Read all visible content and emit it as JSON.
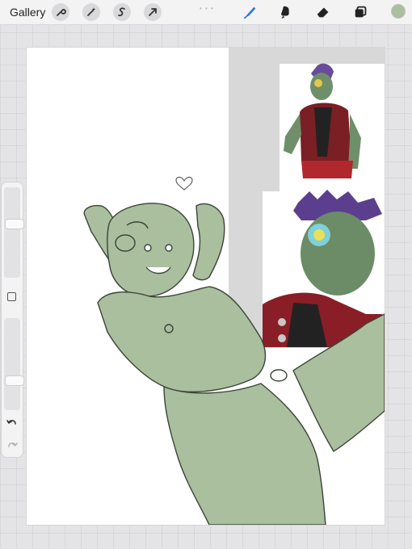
{
  "toolbar": {
    "gallery_label": "Gallery",
    "left_tools": [
      "wrench-icon",
      "magic-wand-icon",
      "selection-icon",
      "transform-arrow-icon"
    ],
    "right_tools": [
      "brush-icon",
      "smudge-icon",
      "eraser-icon",
      "layers-icon"
    ],
    "active_tool": "brush-icon",
    "active_color": "#a9bf9e",
    "accent": "#2b6ff2"
  },
  "sidebar": {
    "brush_size_level": 0.6,
    "opacity_level": 0.3,
    "modify_button": "square-icon",
    "undo": "undo-icon",
    "redo": "redo-icon",
    "redo_enabled": false
  },
  "canvas": {
    "background": "#ffffff",
    "reference_panel_bg": "#d8d8d8",
    "skin_fill": "#a9bf9e"
  }
}
